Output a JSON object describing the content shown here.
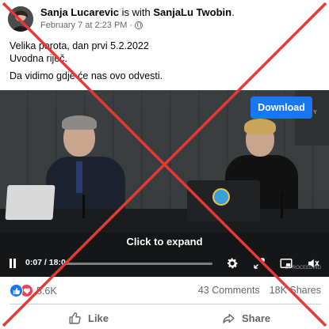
{
  "post": {
    "author": "Sanja Lucarevic",
    "with_text": "is with",
    "tagged": "SanjaLu Twobin",
    "date": "February 7 at 2:23 PM",
    "separator": "·",
    "privacy_icon": "globe-icon",
    "text_line1": "Velika porota, dan prvi 5.2.2022",
    "text_line2": "Uvodna riječ.",
    "text_line3": "Da vidimo gdje će nas ovo odvesti."
  },
  "video": {
    "download_label": "Download",
    "expand_label": "Click to expand",
    "current_time": "0:07",
    "time_separator": " / ",
    "duration": "18:0",
    "progress_fraction": 0.01,
    "overlay_tag": "Y",
    "footer_tag": "L PROCEEDING",
    "icons": [
      "pause-icon",
      "gear-icon",
      "fullscreen-icon",
      "picture-in-picture-icon",
      "volume-icon"
    ]
  },
  "stats": {
    "reaction_count": "5.6K",
    "comments": "43 Comments",
    "shares": "18K Shares",
    "reaction_icons": [
      "like-reaction-icon",
      "love-reaction-icon"
    ]
  },
  "actions": {
    "like_label": "Like",
    "share_label": "Share"
  },
  "overlay": {
    "cross_color": "#e53935"
  },
  "colors": {
    "brand_blue": "#1877f2",
    "muted_text": "#65676b"
  }
}
